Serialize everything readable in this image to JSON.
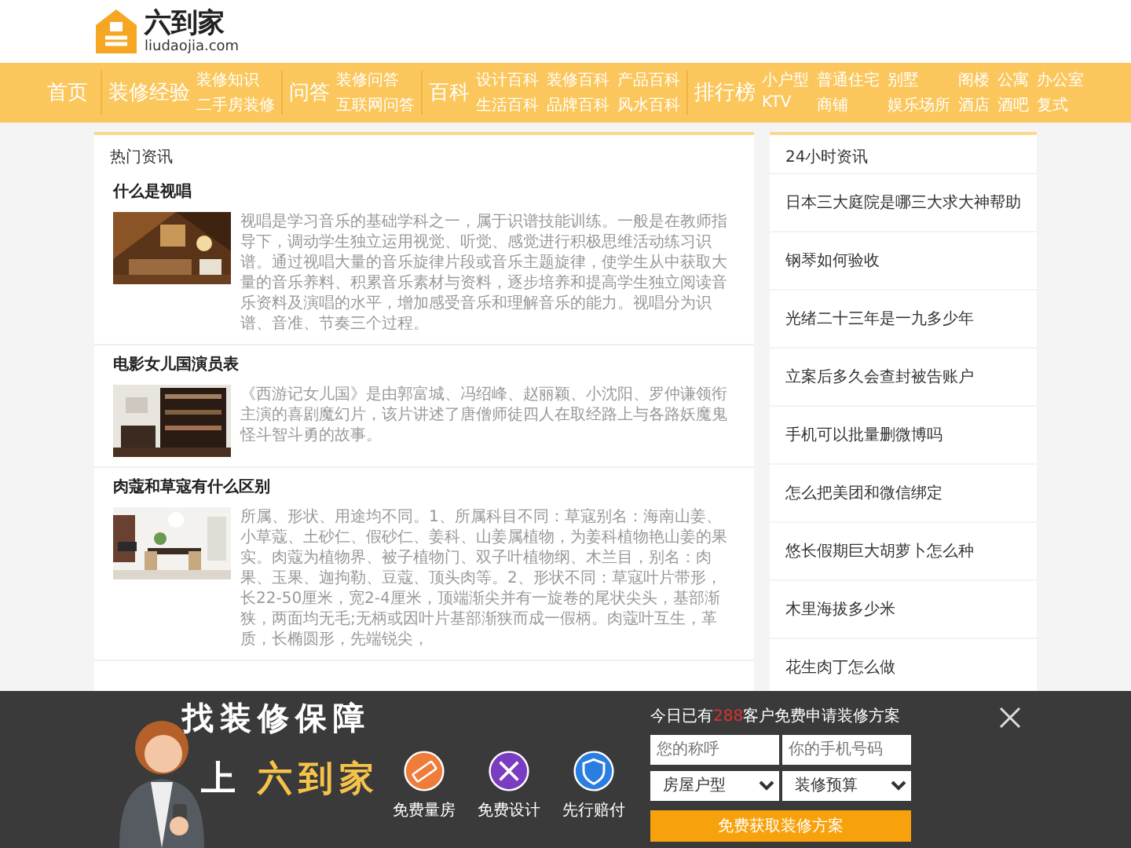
{
  "logo": {
    "name": "六到家",
    "domain": "liudaojia.com"
  },
  "nav": [
    {
      "title": "首页"
    },
    {
      "title": "装修经验",
      "links": [
        "装修知识",
        "二手房装修"
      ]
    },
    {
      "title": "问答",
      "links": [
        "装修问答",
        "互联网问答"
      ]
    },
    {
      "title": "百科",
      "links": [
        "设计百科",
        "生活百科",
        "装修百科",
        "品牌百科",
        "产品百科",
        "风水百科"
      ]
    },
    {
      "title": "排行榜",
      "links": [
        "小户型",
        "KTV",
        "普通住宅",
        "商铺",
        "别墅",
        "娱乐场所",
        "阁楼",
        "酒店",
        "公寓",
        "酒吧",
        "办公室",
        "复式"
      ]
    }
  ],
  "hot_news": {
    "title": "热门资讯",
    "articles": [
      {
        "title": "什么是视唱",
        "summary": "视唱是学习音乐的基础学科之一，属于识谱技能训练。一般是在教师指导下，调动学生独立运用视觉、听觉、感觉进行积极思维活动练习识谱。通过视唱大量的音乐旋律片段或音乐主题旋律，使学生从中获取大量的音乐养料、积累音乐素材与资料，逐步培养和提高学生独立阅读音乐资料及演唱的水平，增加感受音乐和理解音乐的能力。视唱分为识谱、音准、节奏三个过程。"
      },
      {
        "title": "电影女儿国演员表",
        "summary": "《西游记女儿国》是由郭富城、冯绍峰、赵丽颖、小沈阳、罗仲谦领衔主演的喜剧魔幻片，该片讲述了唐僧师徒四人在取经路上与各路妖魔鬼怪斗智斗勇的故事。"
      },
      {
        "title": "肉蔻和草寇有什么区别",
        "summary": "所属、形状、用途均不同。1、所属科目不同：草寇别名：海南山姜、小草蔻、土砂仁、假砂仁、姜科、山姜属植物，为姜科植物艳山姜的果实。肉蔻为植物界、被子植物门、双子叶植物纲、木兰目，别名：肉果、玉果、迦拘勒、豆蔻、顶头肉等。2、形状不同：草寇叶片带形，长22-50厘米，宽2-4厘米，顶端渐尖并有一旋卷的尾状尖头，基部渐狭，两面均无毛;无柄或因叶片基部渐狭而成一假柄。肉蔻叶互生，革质，长椭圆形，先端锐尖，"
      }
    ]
  },
  "news_24h": {
    "title": "24小时资讯",
    "items": [
      "日本三大庭院是哪三大求大神帮助",
      "钢琴如何验收",
      "光绪二十三年是一九多少年",
      "立案后多久会查封被告账户",
      "手机可以批量删微博吗",
      "怎么把美团和微信绑定",
      "悠长假期巨大胡萝卜怎么种",
      "木里海拔多少米",
      "花生肉丁怎么做"
    ]
  },
  "promo": {
    "headline": "找装修保障",
    "subline_prefix": "上",
    "subline_brand": "六到家",
    "perks": [
      {
        "kind": "ruler",
        "label": "免费量房",
        "color": "#f07c3c"
      },
      {
        "kind": "design",
        "label": "免费设计",
        "color": "#7a3cc0"
      },
      {
        "kind": "shield",
        "label": "先行赔付",
        "color": "#2a7ee0"
      }
    ],
    "form": {
      "title_prefix": "今日已有",
      "count": "288",
      "title_suffix": "客户免费申请装修方案",
      "name_field": {
        "placeholder": "您的称呼"
      },
      "phone_field": {
        "placeholder": "你的手机号码"
      },
      "house_type": "房屋户型",
      "budget": "装修预算",
      "submit": "免费获取装修方案"
    }
  }
}
